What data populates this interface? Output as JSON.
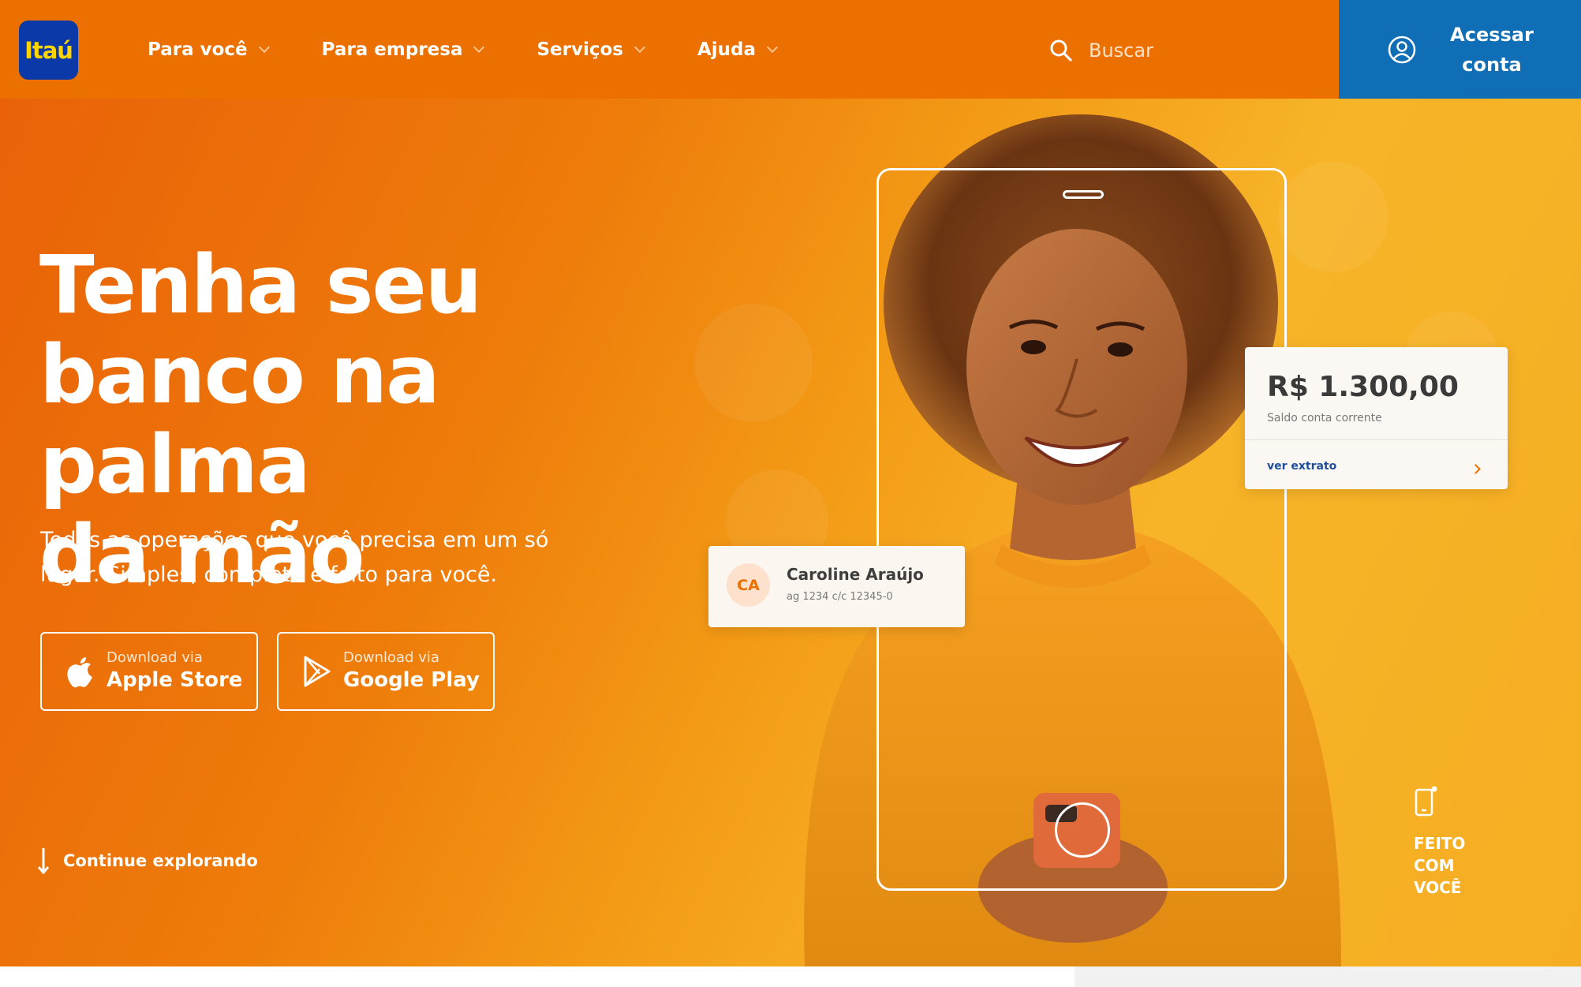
{
  "brand": {
    "logo_text": "Itaú",
    "primary": "#ec7000",
    "logo_bg": "#0b3aa8",
    "logo_fg": "#ffd400",
    "login_bg": "#106eb6"
  },
  "nav": {
    "items": [
      {
        "label": "Para você",
        "icon": "chevron-down-icon"
      },
      {
        "label": "Para empresa",
        "icon": "chevron-down-icon"
      },
      {
        "label": "Serviços",
        "icon": "chevron-down-icon"
      },
      {
        "label": "Ajuda",
        "icon": "chevron-down-icon"
      }
    ]
  },
  "search": {
    "label": "Buscar",
    "icon": "search-icon"
  },
  "login": {
    "line1": "Acessar",
    "line2": "conta",
    "icon": "user-circle-icon"
  },
  "hero": {
    "headline_line1": "Tenha seu",
    "headline_line2": "banco na palma",
    "headline_line3": "da mão",
    "subtext_line1": "Todas as operações que você precisa em um só",
    "subtext_line2": "lugar. Simples, completo e feito para você.",
    "apple": {
      "small": "Download via",
      "big": "Apple Store",
      "icon": "apple-icon"
    },
    "google": {
      "small": "Download via",
      "big": "Google Play",
      "icon": "google-play-icon"
    },
    "explore": {
      "label": "Continue explorando",
      "icon": "arrow-down-icon"
    }
  },
  "balance_card": {
    "amount": "R$ 1.300,00",
    "description": "Saldo conta corrente",
    "link": "ver extrato",
    "icon": "chevron-right-icon"
  },
  "profile_card": {
    "initials": "CA",
    "name": "Caroline Araújo",
    "account": "ag 1234  c/c 12345-0"
  },
  "badge": {
    "line1": "FEITO",
    "line2": "COM",
    "line3": "VOCÊ",
    "icon": "phone-icon"
  }
}
